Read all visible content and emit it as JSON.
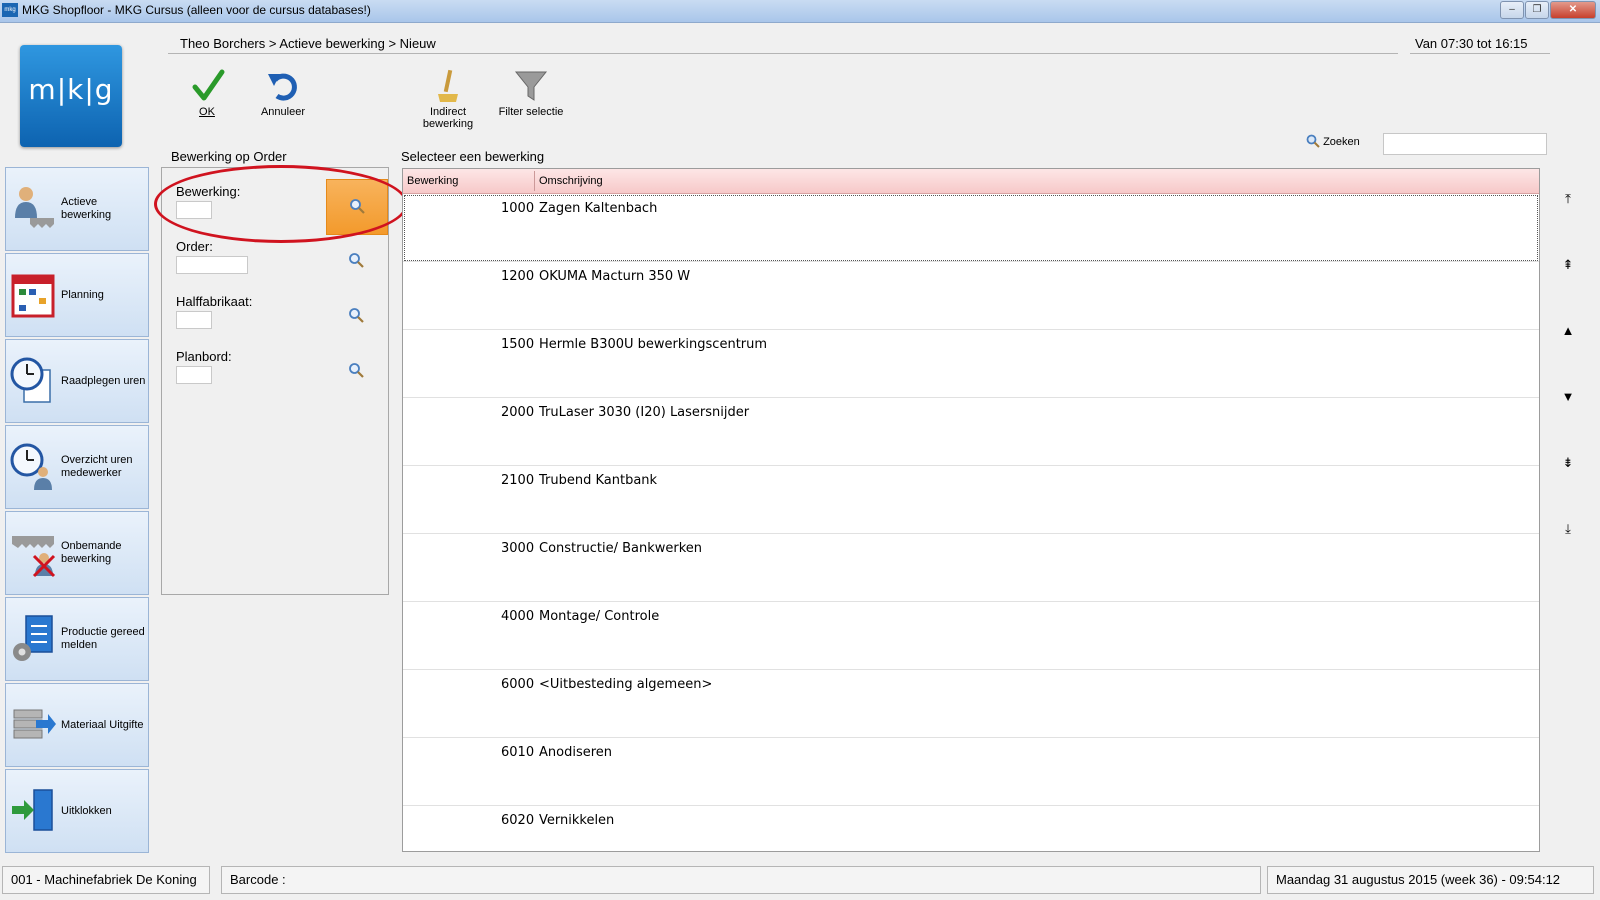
{
  "window": {
    "title": "MKG Shopfloor - MKG Cursus (alleen voor de cursus databases!)",
    "app_icon_text": "mkg",
    "minimize_glyph": "–",
    "maximize_glyph": "❐",
    "close_glyph": "✕"
  },
  "logo": {
    "text": "m|k|g"
  },
  "header": {
    "breadcrumb": "Theo Borchers > Actieve bewerking > Nieuw",
    "shift": "Van 07:30 tot 16:15"
  },
  "toolbar": {
    "ok_label": "OK",
    "cancel_label": "Annuleer",
    "indirect_label_line1": "Indirect",
    "indirect_label_line2": "bewerking",
    "filter_label": "Filter selectie"
  },
  "search": {
    "label": "Zoeken",
    "value": ""
  },
  "nav": [
    {
      "label": "Actieve bewerking",
      "icon": "worker-saw-icon"
    },
    {
      "label": "Planning",
      "icon": "calendar-icon"
    },
    {
      "label": "Raadplegen uren",
      "icon": "clock-document-icon"
    },
    {
      "label": "Overzicht uren medewerker",
      "icon": "clock-person-icon"
    },
    {
      "label": "Onbemande bewerking",
      "icon": "saw-no-person-icon"
    },
    {
      "label": "Productie gereed melden",
      "icon": "gear-document-icon"
    },
    {
      "label": "Materiaal Uitgifte",
      "icon": "stack-arrow-icon"
    },
    {
      "label": "Uitklokken",
      "icon": "door-exit-icon"
    }
  ],
  "left_panel": {
    "title": "Bewerking op Order",
    "fields": [
      {
        "label": "Bewerking:",
        "value": ""
      },
      {
        "label": "Order:",
        "value": ""
      },
      {
        "label": "Halffabrikaat:",
        "value": ""
      },
      {
        "label": "Planbord:",
        "value": ""
      }
    ]
  },
  "grid": {
    "title": "Selecteer een bewerking",
    "columns": [
      "Bewerking",
      "Omschrijving"
    ],
    "rows": [
      {
        "code": "1000",
        "desc": "Zagen Kaltenbach"
      },
      {
        "code": "1200",
        "desc": "OKUMA Macturn 350 W"
      },
      {
        "code": "1500",
        "desc": "Hermle B300U bewerkingscentrum"
      },
      {
        "code": "2000",
        "desc": "TruLaser 3030 (I20) Lasersnijder"
      },
      {
        "code": "2100",
        "desc": "Trubend Kantbank"
      },
      {
        "code": "3000",
        "desc": "Constructie/ Bankwerken"
      },
      {
        "code": "4000",
        "desc": "Montage/ Controle"
      },
      {
        "code": "6000",
        "desc": "<Uitbesteding algemeen>"
      },
      {
        "code": "6010",
        "desc": "Anodiseren"
      },
      {
        "code": "6020",
        "desc": "Vernikkelen"
      }
    ]
  },
  "scroll": {
    "first": "⤒",
    "page_up": "⇞",
    "up": "▲",
    "down": "▼",
    "page_down": "⇟",
    "last": "⤓"
  },
  "status": {
    "company": "001 - Machinefabriek De Koning",
    "barcode_label": "Barcode :",
    "datetime": "Maandag 31 augustus 2015 (week 36) - 09:54:12"
  },
  "colors": {
    "accent_orange": "#f39a2c",
    "highlight_ring": "#d0131f",
    "grid_header": "#f7c9c9",
    "logo_blue": "#0d63b0"
  }
}
